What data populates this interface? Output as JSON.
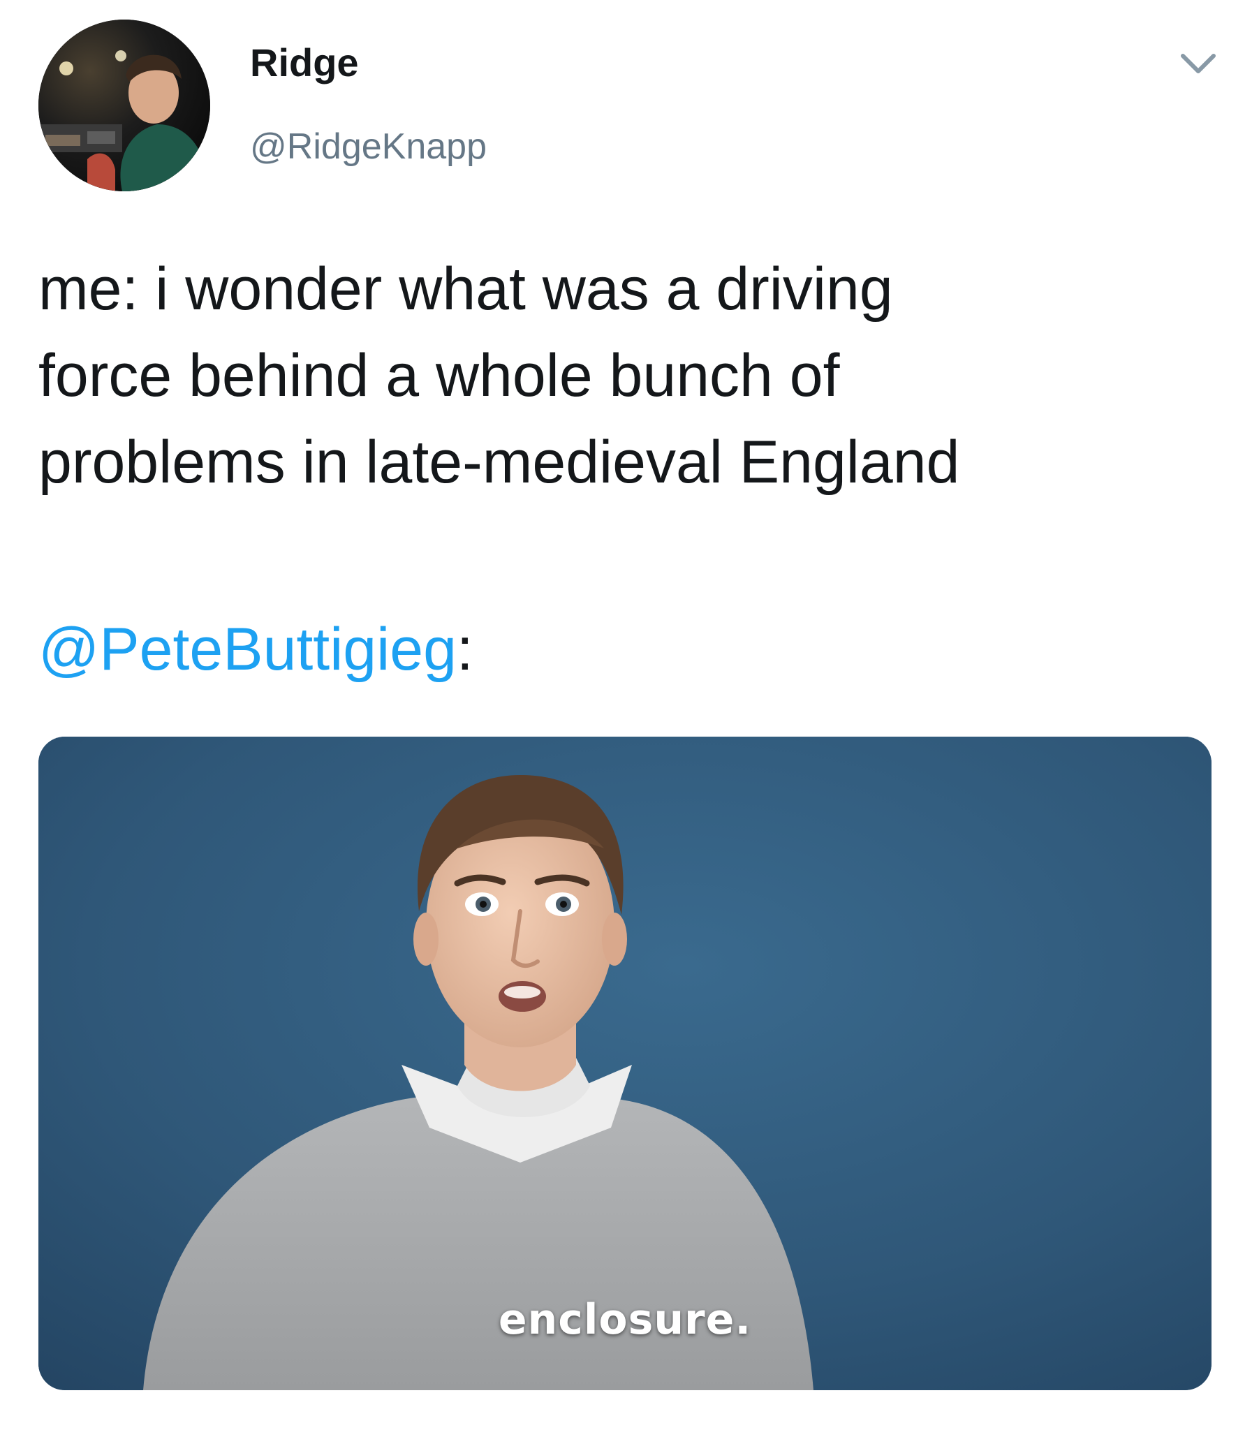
{
  "tweet": {
    "author": {
      "display_name": "Ridge",
      "handle": "@RidgeKnapp"
    },
    "text_lines": [
      "me: i wonder what was a driving",
      "force behind a whole bunch of",
      "problems in late-medieval England"
    ],
    "mention": "@PeteButtigieg",
    "mention_suffix": ":",
    "media": {
      "caption": "enclosure."
    }
  },
  "icons": {
    "menu": "chevron-down-icon"
  },
  "colors": {
    "text": "#14171a",
    "secondary_text": "#657786",
    "link": "#1da1f2",
    "media_background": "#2f5577"
  }
}
